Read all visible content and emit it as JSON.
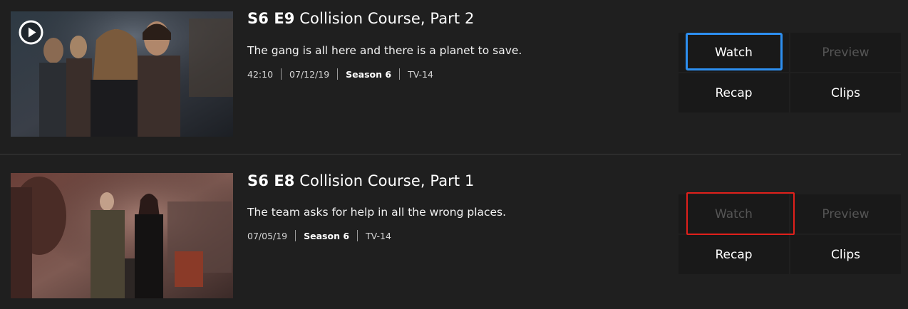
{
  "episodes": [
    {
      "ep_label": "S6 E9",
      "title": "Collision Course, Part 2",
      "description": "The gang is all here and there is a planet to save.",
      "meta": [
        "42:10",
        "07/12/19",
        "Season 6",
        "TV-14"
      ],
      "buttons": {
        "watch": "Watch",
        "preview": "Preview",
        "recap": "Recap",
        "clips": "Clips"
      },
      "watch_state": "focused",
      "preview_state": "disabled",
      "focus_color": "#2d8ff0",
      "has_play_icon": true
    },
    {
      "ep_label": "S6 E8",
      "title": "Collision Course, Part 1",
      "description": "The team asks for help in all the wrong places.",
      "meta": [
        "07/05/19",
        "Season 6",
        "TV-14"
      ],
      "buttons": {
        "watch": "Watch",
        "preview": "Preview",
        "recap": "Recap",
        "clips": "Clips"
      },
      "watch_state": "disabled-highlighted",
      "preview_state": "disabled",
      "focus_color": "#e0201b",
      "has_play_icon": false
    }
  ],
  "icons": {
    "play": "play-circle-icon"
  },
  "colors": {
    "background": "#1f1f1f",
    "button_bg": "#191919",
    "disabled_text": "#555555",
    "divider": "#3a3a3a"
  }
}
